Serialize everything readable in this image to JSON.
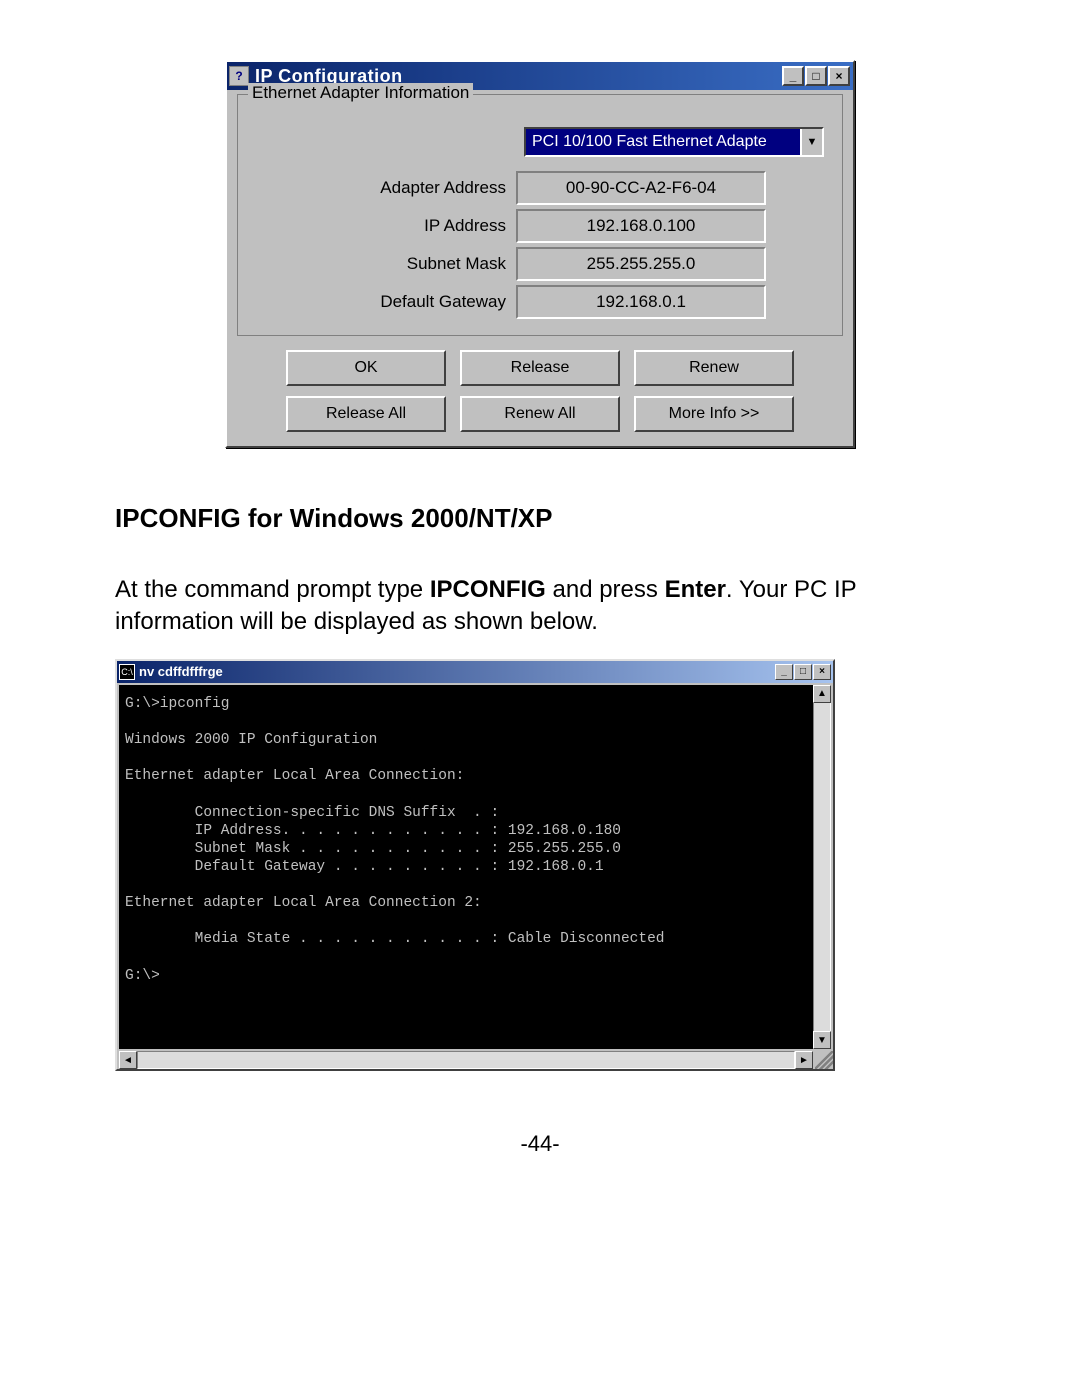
{
  "ipcfg": {
    "window_title": "IP Configuration",
    "group_title": "Ethernet Adapter Information",
    "adapter_selected": "PCI 10/100 Fast Ethernet Adapte",
    "fields": {
      "adapter_address_label": "Adapter Address",
      "adapter_address_value": "00-90-CC-A2-F6-04",
      "ip_address_label": "IP Address",
      "ip_address_value": "192.168.0.100",
      "subnet_mask_label": "Subnet Mask",
      "subnet_mask_value": "255.255.255.0",
      "default_gateway_label": "Default Gateway",
      "default_gateway_value": "192.168.0.1"
    },
    "buttons": {
      "ok": "OK",
      "release": "Release",
      "renew": "Renew",
      "release_all": "Release All",
      "renew_all": "Renew All",
      "more_info": "More Info >>"
    }
  },
  "doc": {
    "heading": "IPCONFIG for Windows 2000/NT/XP",
    "para_a": "At the command prompt type ",
    "para_b": "IPCONFIG",
    "para_c": " and press ",
    "para_d": "Enter",
    "para_e": ". Your PC IP information will be displayed as shown below.",
    "page_number": "-44-"
  },
  "cmd": {
    "window_title": "nv cdffdfffrge",
    "output": "G:\\>ipconfig\n\nWindows 2000 IP Configuration\n\nEthernet adapter Local Area Connection:\n\n        Connection-specific DNS Suffix  . :\n        IP Address. . . . . . . . . . . . : 192.168.0.180\n        Subnet Mask . . . . . . . . . . . : 255.255.255.0\n        Default Gateway . . . . . . . . . : 192.168.0.1\n\nEthernet adapter Local Area Connection 2:\n\n        Media State . . . . . . . . . . . : Cable Disconnected\n\nG:\\>\n\n\n\n"
  }
}
